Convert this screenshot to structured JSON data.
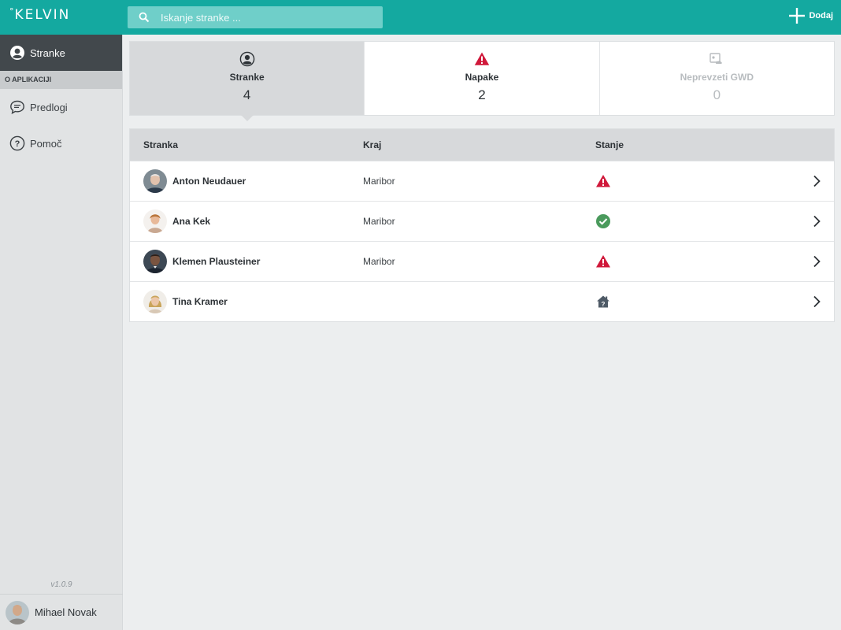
{
  "app": {
    "logo": "KELVIN",
    "logo_mark": "°"
  },
  "search": {
    "placeholder": "Iskanje stranke ..."
  },
  "toolbar": {
    "add_label": "Dodaj"
  },
  "sidebar": {
    "active_item": {
      "label": "Stranke",
      "icon": "person-circle-icon"
    },
    "section_title": "O APLIKACIJI",
    "items": [
      {
        "label": "Predlogi",
        "icon": "chat-bubble-icon"
      },
      {
        "label": "Pomoč",
        "icon": "help-circle-icon"
      }
    ],
    "version": "v1.0.9",
    "user_name": "Mihael Novak"
  },
  "summary": {
    "cards": [
      {
        "label": "Stranke",
        "count": "4",
        "icon": "person-circle-icon"
      },
      {
        "label": "Napake",
        "count": "2",
        "icon": "warning-icon"
      },
      {
        "label": "Neprevzeti GWD",
        "count": "0",
        "icon": "device-cloud-icon"
      }
    ]
  },
  "table": {
    "headers": [
      "Stranka",
      "Kraj",
      "Stanje"
    ],
    "rows": [
      {
        "name": "Anton Neudauer",
        "city": "Maribor",
        "status": "warning"
      },
      {
        "name": "Ana Kek",
        "city": "Maribor",
        "status": "ok"
      },
      {
        "name": "Klemen Plausteiner",
        "city": "Maribor",
        "status": "warning"
      },
      {
        "name": "Tina Kramer",
        "city": "",
        "status": "house-question"
      }
    ]
  },
  "colors": {
    "topbar": "#14a9a0",
    "warning": "#d0183a",
    "ok": "#4a9a5c",
    "sidebar_active": "#42484c"
  }
}
